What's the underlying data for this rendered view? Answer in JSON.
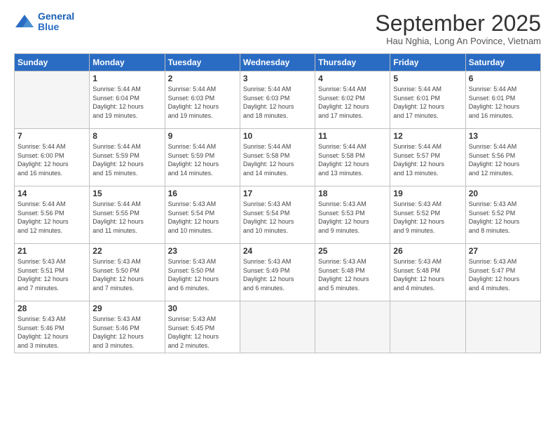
{
  "logo": {
    "line1": "General",
    "line2": "Blue"
  },
  "title": "September 2025",
  "location": "Hau Nghia, Long An Povince, Vietnam",
  "days_header": [
    "Sunday",
    "Monday",
    "Tuesday",
    "Wednesday",
    "Thursday",
    "Friday",
    "Saturday"
  ],
  "weeks": [
    [
      {
        "day": "",
        "info": ""
      },
      {
        "day": "1",
        "info": "Sunrise: 5:44 AM\nSunset: 6:04 PM\nDaylight: 12 hours\nand 19 minutes."
      },
      {
        "day": "2",
        "info": "Sunrise: 5:44 AM\nSunset: 6:03 PM\nDaylight: 12 hours\nand 19 minutes."
      },
      {
        "day": "3",
        "info": "Sunrise: 5:44 AM\nSunset: 6:03 PM\nDaylight: 12 hours\nand 18 minutes."
      },
      {
        "day": "4",
        "info": "Sunrise: 5:44 AM\nSunset: 6:02 PM\nDaylight: 12 hours\nand 17 minutes."
      },
      {
        "day": "5",
        "info": "Sunrise: 5:44 AM\nSunset: 6:01 PM\nDaylight: 12 hours\nand 17 minutes."
      },
      {
        "day": "6",
        "info": "Sunrise: 5:44 AM\nSunset: 6:01 PM\nDaylight: 12 hours\nand 16 minutes."
      }
    ],
    [
      {
        "day": "7",
        "info": "Sunrise: 5:44 AM\nSunset: 6:00 PM\nDaylight: 12 hours\nand 16 minutes."
      },
      {
        "day": "8",
        "info": "Sunrise: 5:44 AM\nSunset: 5:59 PM\nDaylight: 12 hours\nand 15 minutes."
      },
      {
        "day": "9",
        "info": "Sunrise: 5:44 AM\nSunset: 5:59 PM\nDaylight: 12 hours\nand 14 minutes."
      },
      {
        "day": "10",
        "info": "Sunrise: 5:44 AM\nSunset: 5:58 PM\nDaylight: 12 hours\nand 14 minutes."
      },
      {
        "day": "11",
        "info": "Sunrise: 5:44 AM\nSunset: 5:58 PM\nDaylight: 12 hours\nand 13 minutes."
      },
      {
        "day": "12",
        "info": "Sunrise: 5:44 AM\nSunset: 5:57 PM\nDaylight: 12 hours\nand 13 minutes."
      },
      {
        "day": "13",
        "info": "Sunrise: 5:44 AM\nSunset: 5:56 PM\nDaylight: 12 hours\nand 12 minutes."
      }
    ],
    [
      {
        "day": "14",
        "info": "Sunrise: 5:44 AM\nSunset: 5:56 PM\nDaylight: 12 hours\nand 12 minutes."
      },
      {
        "day": "15",
        "info": "Sunrise: 5:44 AM\nSunset: 5:55 PM\nDaylight: 12 hours\nand 11 minutes."
      },
      {
        "day": "16",
        "info": "Sunrise: 5:43 AM\nSunset: 5:54 PM\nDaylight: 12 hours\nand 10 minutes."
      },
      {
        "day": "17",
        "info": "Sunrise: 5:43 AM\nSunset: 5:54 PM\nDaylight: 12 hours\nand 10 minutes."
      },
      {
        "day": "18",
        "info": "Sunrise: 5:43 AM\nSunset: 5:53 PM\nDaylight: 12 hours\nand 9 minutes."
      },
      {
        "day": "19",
        "info": "Sunrise: 5:43 AM\nSunset: 5:52 PM\nDaylight: 12 hours\nand 9 minutes."
      },
      {
        "day": "20",
        "info": "Sunrise: 5:43 AM\nSunset: 5:52 PM\nDaylight: 12 hours\nand 8 minutes."
      }
    ],
    [
      {
        "day": "21",
        "info": "Sunrise: 5:43 AM\nSunset: 5:51 PM\nDaylight: 12 hours\nand 7 minutes."
      },
      {
        "day": "22",
        "info": "Sunrise: 5:43 AM\nSunset: 5:50 PM\nDaylight: 12 hours\nand 7 minutes."
      },
      {
        "day": "23",
        "info": "Sunrise: 5:43 AM\nSunset: 5:50 PM\nDaylight: 12 hours\nand 6 minutes."
      },
      {
        "day": "24",
        "info": "Sunrise: 5:43 AM\nSunset: 5:49 PM\nDaylight: 12 hours\nand 6 minutes."
      },
      {
        "day": "25",
        "info": "Sunrise: 5:43 AM\nSunset: 5:48 PM\nDaylight: 12 hours\nand 5 minutes."
      },
      {
        "day": "26",
        "info": "Sunrise: 5:43 AM\nSunset: 5:48 PM\nDaylight: 12 hours\nand 4 minutes."
      },
      {
        "day": "27",
        "info": "Sunrise: 5:43 AM\nSunset: 5:47 PM\nDaylight: 12 hours\nand 4 minutes."
      }
    ],
    [
      {
        "day": "28",
        "info": "Sunrise: 5:43 AM\nSunset: 5:46 PM\nDaylight: 12 hours\nand 3 minutes."
      },
      {
        "day": "29",
        "info": "Sunrise: 5:43 AM\nSunset: 5:46 PM\nDaylight: 12 hours\nand 3 minutes."
      },
      {
        "day": "30",
        "info": "Sunrise: 5:43 AM\nSunset: 5:45 PM\nDaylight: 12 hours\nand 2 minutes."
      },
      {
        "day": "",
        "info": ""
      },
      {
        "day": "",
        "info": ""
      },
      {
        "day": "",
        "info": ""
      },
      {
        "day": "",
        "info": ""
      }
    ]
  ]
}
